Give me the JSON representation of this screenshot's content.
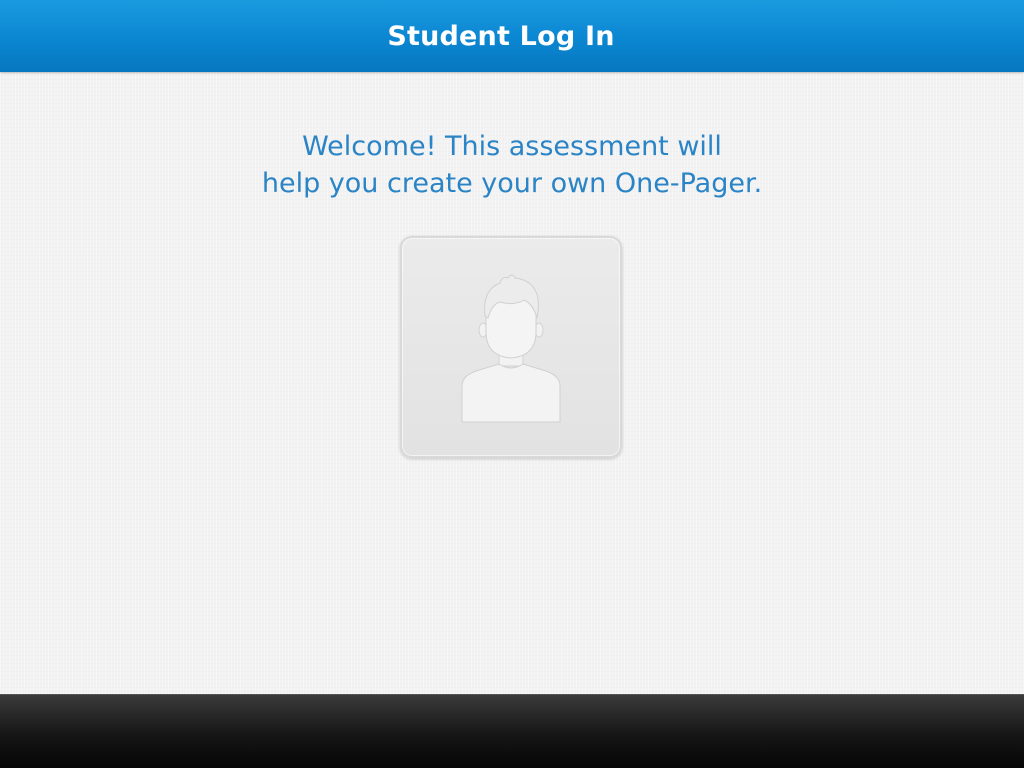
{
  "header": {
    "title": "Student Log In"
  },
  "welcome": {
    "line1": "Welcome! This assessment will",
    "line2": "help you create your own One-Pager."
  },
  "avatar": {
    "icon": "user-avatar-placeholder-icon"
  },
  "colors": {
    "header_blue": "#0b86d1",
    "welcome_text": "#2a84c6",
    "footer_black": "#161616",
    "background": "#f2f2f2"
  }
}
